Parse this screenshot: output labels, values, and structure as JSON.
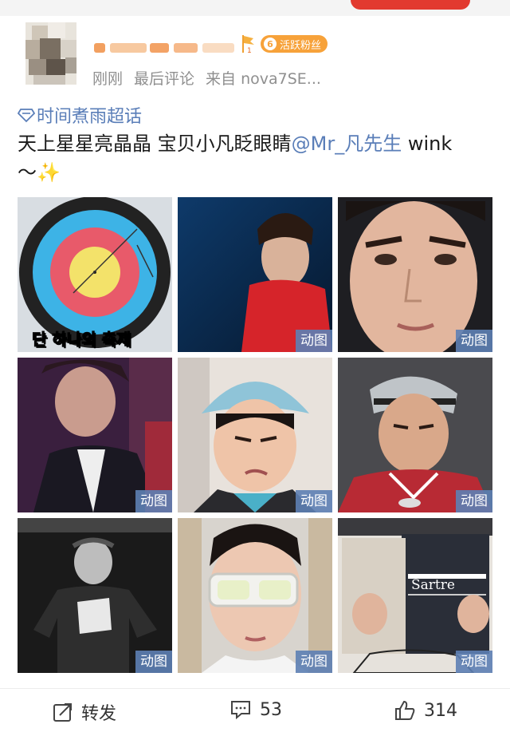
{
  "post": {
    "username": "",
    "badge": {
      "level": "6",
      "label": "活跃粉丝"
    },
    "meta": {
      "time": "刚刚",
      "sort": "最后评论",
      "source": "来自 nova7SE..."
    },
    "supertopic": "时间煮雨超话",
    "text_main": "天上星星亮晶晶 宝贝小凡眨眼睛",
    "mention": "@Mr_凡先生",
    "text_after_mention": " wink",
    "text_line2": "～✨"
  },
  "images": [
    {
      "name": "image-1-archery-target",
      "tag": "",
      "caption": "단 하나의 축제"
    },
    {
      "name": "image-2-red-shirt-stage",
      "tag": "动图"
    },
    {
      "name": "image-3-closeup-face",
      "tag": "动图"
    },
    {
      "name": "image-4-dark-suit",
      "tag": "动图"
    },
    {
      "name": "image-5-bucket-hat",
      "tag": "动图"
    },
    {
      "name": "image-6-basketball-jersey",
      "tag": "动图"
    },
    {
      "name": "image-7-bw-tshirt",
      "tag": "动图"
    },
    {
      "name": "image-8-sunglasses",
      "tag": "动图"
    },
    {
      "name": "image-9-sartre-book",
      "tag": "动图",
      "caption": "Sartre"
    }
  ],
  "actions": {
    "repost_label": "转发",
    "comment_count": "53",
    "like_count": "314"
  },
  "colors": {
    "link": "#5a7eb8",
    "badge": "#f7a23a",
    "gif_tag": "#5d80b4",
    "meta_gray": "#8f8f8f"
  },
  "icons": [
    "diamond-supertopic-icon",
    "repost-icon",
    "comment-icon",
    "like-icon"
  ]
}
